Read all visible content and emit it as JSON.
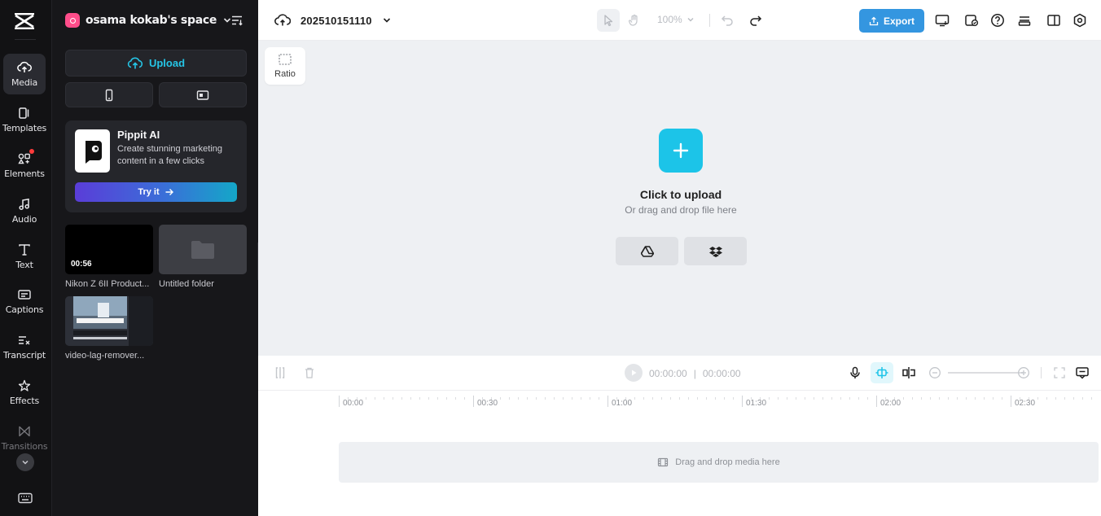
{
  "rail": {
    "items": [
      {
        "id": "media",
        "label": "Media",
        "active": true
      },
      {
        "id": "templates",
        "label": "Templates"
      },
      {
        "id": "elements",
        "label": "Elements",
        "badge": true
      },
      {
        "id": "audio",
        "label": "Audio"
      },
      {
        "id": "text",
        "label": "Text"
      },
      {
        "id": "captions",
        "label": "Captions"
      },
      {
        "id": "transcript",
        "label": "Transcript"
      },
      {
        "id": "effects",
        "label": "Effects"
      },
      {
        "id": "transitions",
        "label": "Transitions",
        "dim": true
      }
    ]
  },
  "panel": {
    "workspace_name": "osama kokab's space",
    "upload_label": "Upload",
    "promo": {
      "title": "Pippit AI",
      "description": "Create stunning marketing content in a few clicks",
      "button_label": "Try it"
    },
    "media": [
      {
        "name": "Nikon Z 6II Product...",
        "duration": "00:56",
        "kind": "video"
      },
      {
        "name": "Untitled folder",
        "kind": "folder"
      },
      {
        "name": "video-lag-remover...",
        "kind": "image"
      }
    ]
  },
  "topbar": {
    "project_name": "202510151110",
    "zoom": "100%",
    "export_label": "Export",
    "accent": "#3496e0"
  },
  "canvas": {
    "ratio_label": "Ratio",
    "upload_title": "Click to upload",
    "upload_subtitle": "Or drag and drop file here"
  },
  "timeline": {
    "current_time": "00:00:00",
    "total_time": "00:00:00",
    "ruler": [
      "00:00",
      "00:30",
      "01:00",
      "01:30",
      "02:00",
      "02:30"
    ],
    "drop_label": "Drag and drop media here"
  }
}
